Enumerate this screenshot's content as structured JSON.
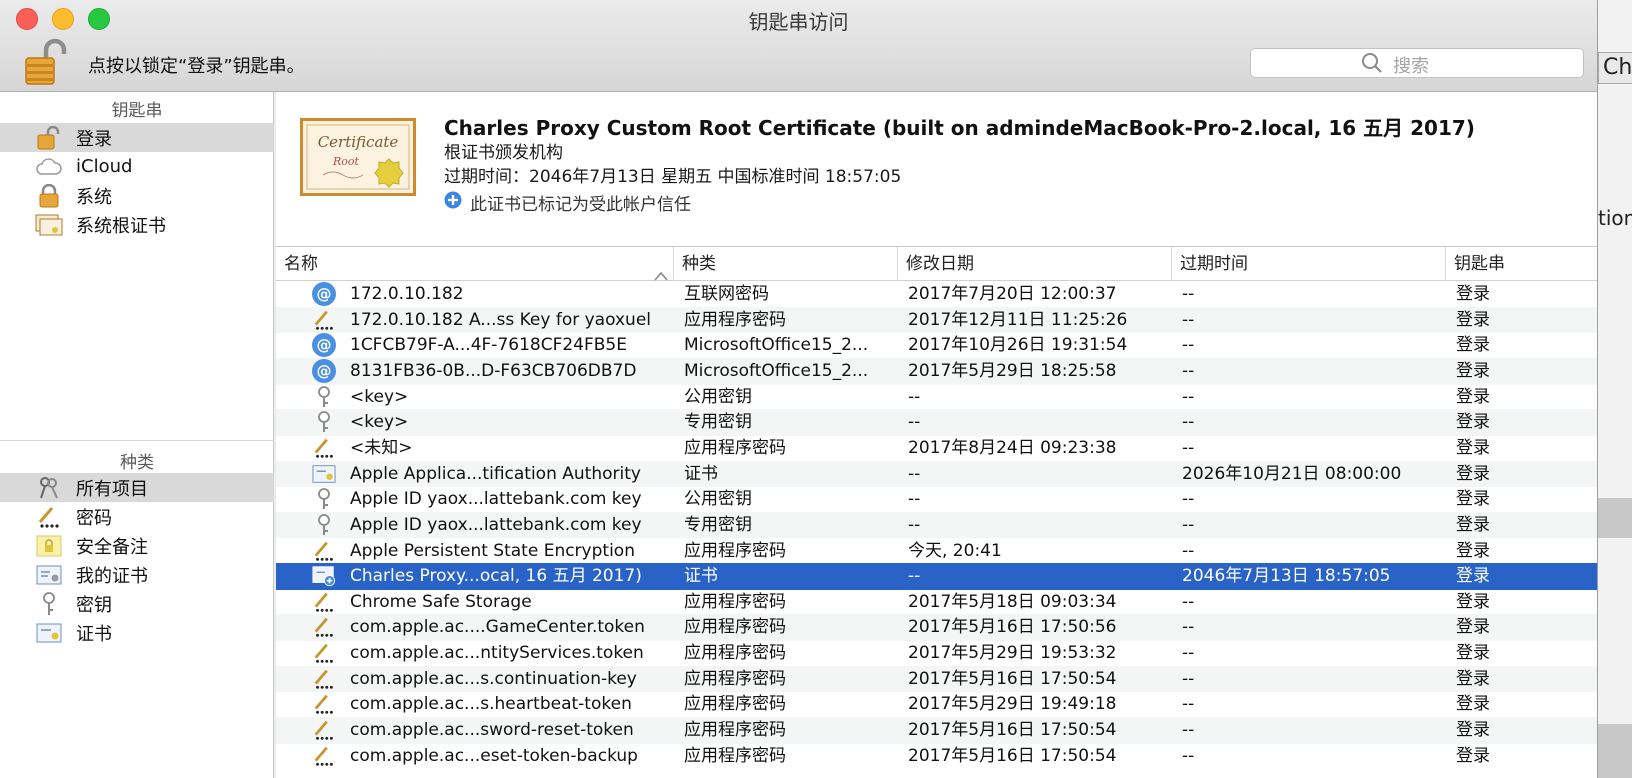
{
  "window": {
    "title": "钥匙串访问",
    "lock_text": "点按以锁定“登录”钥匙串。",
    "search_placeholder": "搜索"
  },
  "background_window": {
    "tab_text": "Ch",
    "side_text": "tion"
  },
  "sidebar": {
    "keychains_header": "钥匙串",
    "keychains": [
      {
        "label": "登录",
        "icon": "padlock-open-icon",
        "selected": true
      },
      {
        "label": "iCloud",
        "icon": "cloud-icon",
        "selected": false
      },
      {
        "label": "系统",
        "icon": "padlock-closed-icon",
        "selected": false
      },
      {
        "label": "系统根证书",
        "icon": "certificates-icon",
        "selected": false
      }
    ],
    "categories_header": "种类",
    "categories": [
      {
        "label": "所有项目",
        "icon": "all-items-icon",
        "selected": true
      },
      {
        "label": "密码",
        "icon": "password-pen-icon",
        "selected": false
      },
      {
        "label": "安全备注",
        "icon": "secure-note-icon",
        "selected": false
      },
      {
        "label": "我的证书",
        "icon": "my-certificate-icon",
        "selected": false
      },
      {
        "label": "密钥",
        "icon": "key-icon",
        "selected": false
      },
      {
        "label": "证书",
        "icon": "certificate-icon",
        "selected": false
      }
    ]
  },
  "detail": {
    "title": "Charles Proxy Custom Root Certificate (built on admindeMacBook-Pro-2.local, 16 五月 2017)",
    "subtitle": "根证书颁发机构",
    "expiry": "过期时间：2046年7月13日 星期五 中国标准时间 18:57:05",
    "trust": "此证书已标记为受此帐户信任",
    "badge_text_1": "Certificate",
    "badge_text_2": "Root"
  },
  "table": {
    "columns": {
      "name": "名称",
      "kind": "种类",
      "modified": "修改日期",
      "expires": "过期时间",
      "keychain": "钥匙串"
    },
    "rows": [
      {
        "icon": "internet-password-icon",
        "name": "172.0.10.182",
        "kind": "互联网密码",
        "modified": "2017年7月20日 12:00:37",
        "expires": "--",
        "keychain": "登录"
      },
      {
        "icon": "app-password-icon",
        "name": "172.0.10.182 A...ss Key for yaoxueli",
        "kind": "应用程序密码",
        "modified": "2017年12月11日 11:25:26",
        "expires": "--",
        "keychain": "登录"
      },
      {
        "icon": "internet-password-icon",
        "name": "1CFCB79F-A...4F-7618CF24FB5E",
        "kind": "MicrosoftOffice15_2...",
        "modified": "2017年10月26日 19:31:54",
        "expires": "--",
        "keychain": "登录"
      },
      {
        "icon": "internet-password-icon",
        "name": "8131FB36-0B...D-F63CB706DB7D",
        "kind": "MicrosoftOffice15_2...",
        "modified": "2017年5月29日 18:25:58",
        "expires": "--",
        "keychain": "登录"
      },
      {
        "icon": "key-icon",
        "name": "<key>",
        "kind": "公用密钥",
        "modified": "--",
        "expires": "--",
        "keychain": "登录"
      },
      {
        "icon": "key-icon",
        "name": "<key>",
        "kind": "专用密钥",
        "modified": "--",
        "expires": "--",
        "keychain": "登录"
      },
      {
        "icon": "app-password-icon",
        "name": "<未知>",
        "kind": "应用程序密码",
        "modified": "2017年8月24日 09:23:38",
        "expires": "--",
        "keychain": "登录"
      },
      {
        "icon": "certificate-icon",
        "name": "Apple Applica...tification Authority",
        "kind": "证书",
        "modified": "--",
        "expires": "2026年10月21日 08:00:00",
        "keychain": "登录"
      },
      {
        "icon": "key-icon",
        "name": "Apple ID yaox...lattebank.com key",
        "kind": "公用密钥",
        "modified": "--",
        "expires": "--",
        "keychain": "登录"
      },
      {
        "icon": "key-icon",
        "name": "Apple ID yaox...lattebank.com key",
        "kind": "专用密钥",
        "modified": "--",
        "expires": "--",
        "keychain": "登录"
      },
      {
        "icon": "app-password-icon",
        "name": "Apple Persistent State Encryption",
        "kind": "应用程序密码",
        "modified": "今天, 20:41",
        "expires": "--",
        "keychain": "登录"
      },
      {
        "icon": "trusted-certificate-icon",
        "name": "Charles Proxy...ocal, 16 五月 2017)",
        "kind": "证书",
        "modified": "--",
        "expires": "2046年7月13日 18:57:05",
        "keychain": "登录",
        "selected": true
      },
      {
        "icon": "app-password-icon",
        "name": "Chrome Safe Storage",
        "kind": "应用程序密码",
        "modified": "2017年5月18日 09:03:34",
        "expires": "--",
        "keychain": "登录"
      },
      {
        "icon": "app-password-icon",
        "name": "com.apple.ac....GameCenter.token",
        "kind": "应用程序密码",
        "modified": "2017年5月16日 17:50:56",
        "expires": "--",
        "keychain": "登录"
      },
      {
        "icon": "app-password-icon",
        "name": "com.apple.ac...ntityServices.token",
        "kind": "应用程序密码",
        "modified": "2017年5月29日 19:53:32",
        "expires": "--",
        "keychain": "登录"
      },
      {
        "icon": "app-password-icon",
        "name": "com.apple.ac...s.continuation-key",
        "kind": "应用程序密码",
        "modified": "2017年5月16日 17:50:54",
        "expires": "--",
        "keychain": "登录"
      },
      {
        "icon": "app-password-icon",
        "name": "com.apple.ac...s.heartbeat-token",
        "kind": "应用程序密码",
        "modified": "2017年5月29日 19:49:18",
        "expires": "--",
        "keychain": "登录"
      },
      {
        "icon": "app-password-icon",
        "name": "com.apple.ac...sword-reset-token",
        "kind": "应用程序密码",
        "modified": "2017年5月16日 17:50:54",
        "expires": "--",
        "keychain": "登录"
      },
      {
        "icon": "app-password-icon",
        "name": "com.apple.ac...eset-token-backup",
        "kind": "应用程序密码",
        "modified": "2017年5月16日 17:50:54",
        "expires": "--",
        "keychain": "登录"
      }
    ]
  }
}
